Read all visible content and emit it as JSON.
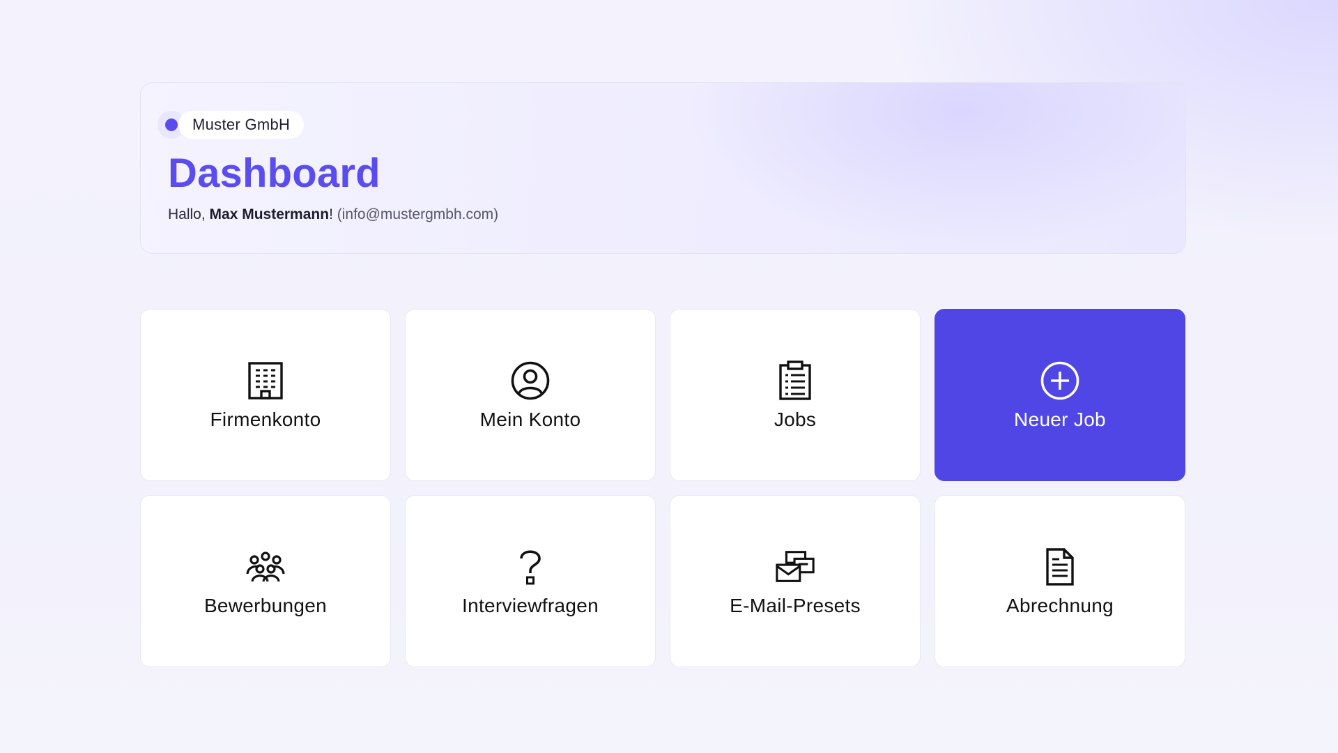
{
  "header": {
    "company": "Muster GmbH",
    "title": "Dashboard",
    "greeting_prefix": "Hallo, ",
    "user_name": "Max Mustermann",
    "greeting_suffix": "! ",
    "email": "(info@mustergmbh.com)"
  },
  "colors": {
    "accent": "#5b4cf0",
    "primary_tile": "#4f46e5"
  },
  "tiles": [
    {
      "label": "Firmenkonto",
      "icon": "building-icon"
    },
    {
      "label": "Mein Konto",
      "icon": "user-circle-icon"
    },
    {
      "label": "Jobs",
      "icon": "clipboard-icon"
    },
    {
      "label": "Neuer Job",
      "icon": "plus-circle-icon",
      "primary": true
    },
    {
      "label": "Bewerbungen",
      "icon": "people-group-icon"
    },
    {
      "label": "Interviewfragen",
      "icon": "question-mark-icon"
    },
    {
      "label": "E-Mail-Presets",
      "icon": "envelopes-icon"
    },
    {
      "label": "Abrechnung",
      "icon": "document-icon"
    }
  ]
}
